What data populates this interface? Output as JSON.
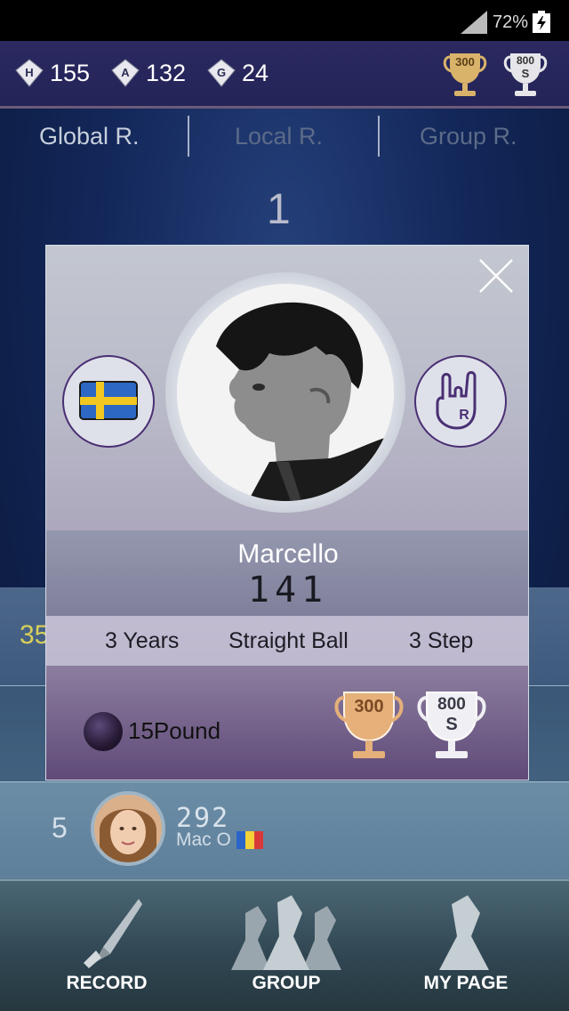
{
  "status_bar": {
    "battery_percent": "72%"
  },
  "stats": [
    {
      "badge": "H",
      "value": "155"
    },
    {
      "badge": "A",
      "value": "132"
    },
    {
      "badge": "G",
      "value": "24"
    }
  ],
  "top_trophies": [
    {
      "label": "300",
      "sub": "",
      "color": "#d9b36a"
    },
    {
      "label": "800",
      "sub": "S",
      "color": "#e6e6ea"
    }
  ],
  "tabs": [
    {
      "label": "Global R.",
      "active": true
    },
    {
      "label": "Local R.",
      "active": false
    },
    {
      "label": "Group R.",
      "active": false
    }
  ],
  "ranking": {
    "top_rank": "1",
    "peek_rank": "35",
    "row5": {
      "rank": "5",
      "score": "292",
      "name": "Mac O"
    }
  },
  "modal": {
    "name": "Marcello",
    "score": "141",
    "experience": "3 Years",
    "style": "Straight Ball",
    "step": "3 Step",
    "ball_weight": "15Pound",
    "trophies": [
      {
        "label": "300",
        "sub": ""
      },
      {
        "label": "800",
        "sub": "S"
      }
    ],
    "rock_badge": "R"
  },
  "nav": [
    {
      "label": "RECORD",
      "icon": "pencil-icon"
    },
    {
      "label": "GROUP",
      "icon": "group-icon"
    },
    {
      "label": "MY PAGE",
      "icon": "user-icon"
    }
  ]
}
